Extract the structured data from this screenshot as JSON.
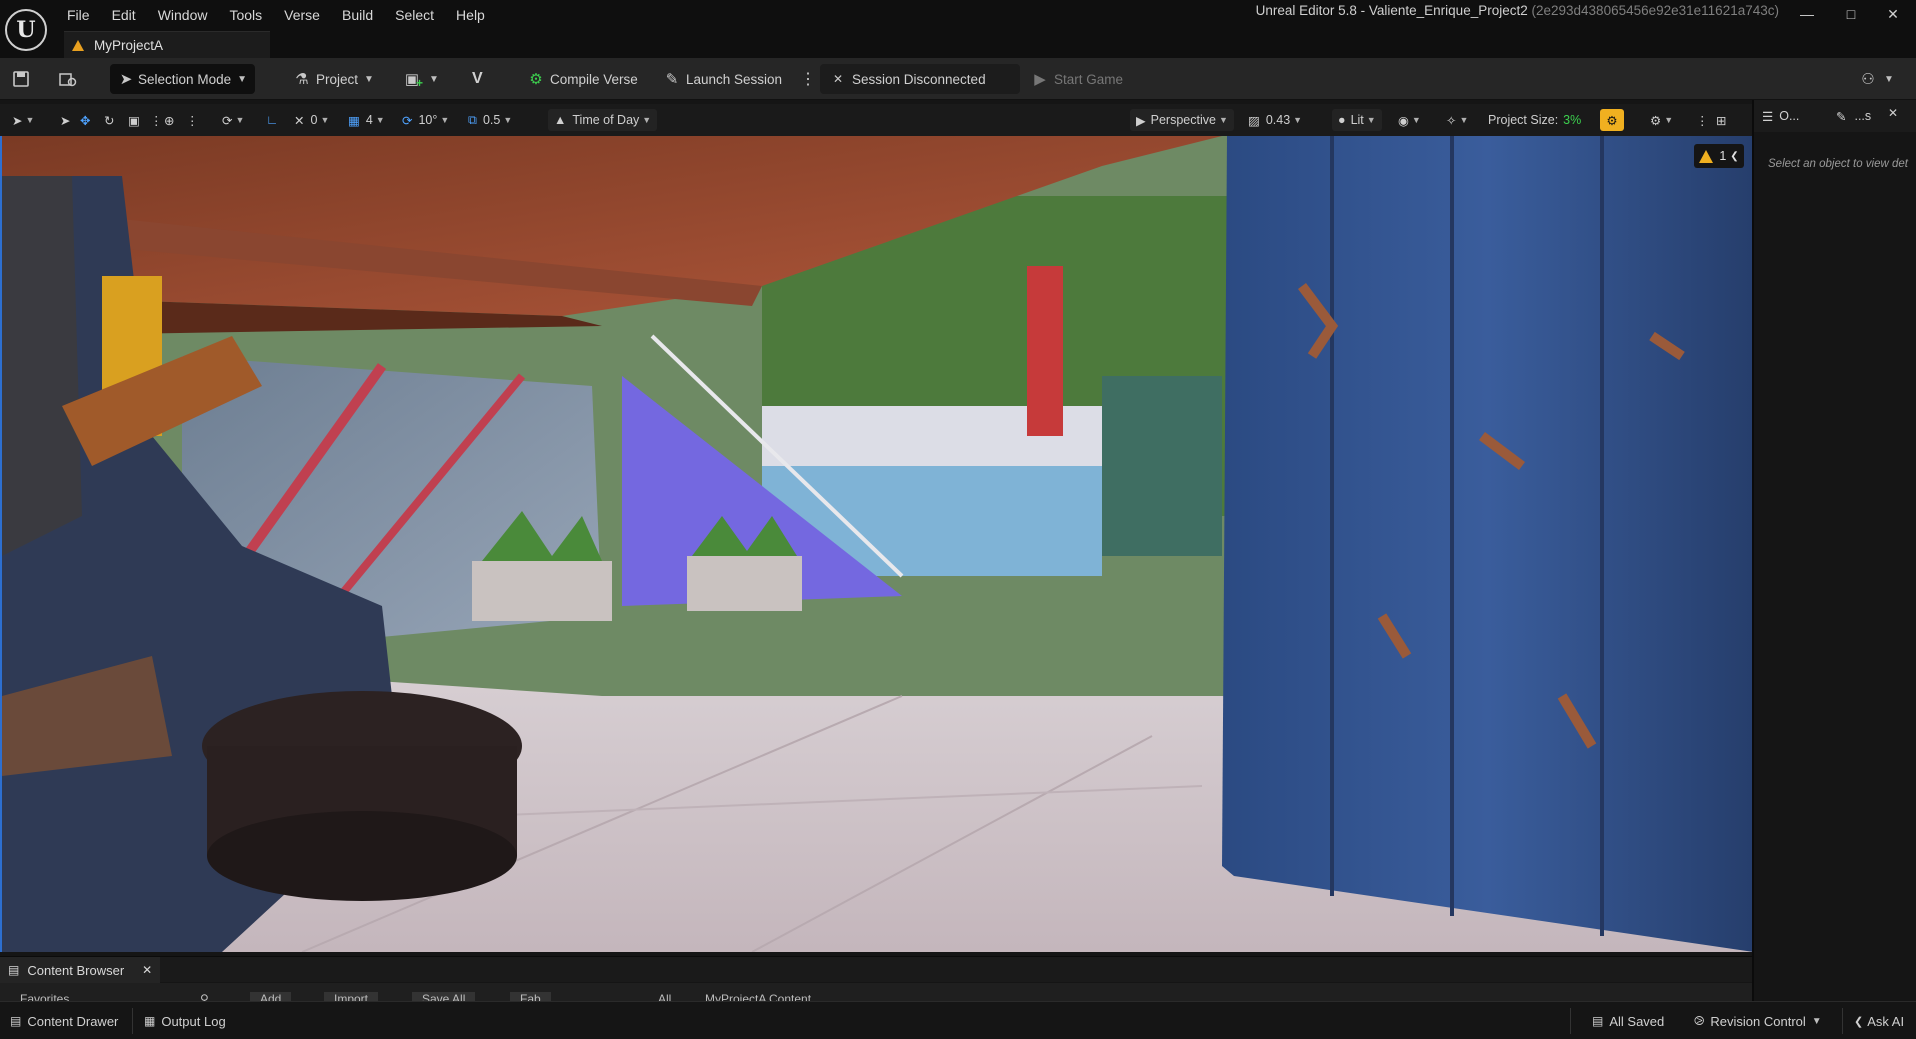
{
  "app": {
    "window_title": "Unreal Editor 5.8 - Valiente_Enrique_Project2",
    "window_hash": "(2e293d438065456e92e31e11621a743c)",
    "project_tab": "MyProjectA"
  },
  "menu": [
    "File",
    "Edit",
    "Window",
    "Tools",
    "Verse",
    "Build",
    "Select",
    "Help"
  ],
  "toolbar": {
    "selection_mode": "Selection Mode",
    "project": "Project",
    "compile_verse": "Compile Verse",
    "launch_session": "Launch Session",
    "session_status": "Session Disconnected",
    "start_game": "Start Game"
  },
  "viewport_toolbar": {
    "rotation_snap": "0",
    "grid_snap": "4",
    "angle_snap": "10°",
    "scale_snap": "0.5",
    "time_of_day": "Time of Day",
    "perspective": "Perspective",
    "camera_speed": "0.43",
    "view_mode": "Lit",
    "project_size_label": "Project Size:",
    "project_size_value": "3%"
  },
  "viewport": {
    "warning_count": "1"
  },
  "side_panel": {
    "outliner_tab": "O...",
    "details_tab": "...s",
    "hint": "Select an object to view det"
  },
  "content_browser": {
    "tab_label": "Content Browser",
    "ghost_favorites": "Favorites",
    "ghost_add": "Add",
    "ghost_import": "Import",
    "ghost_save_all": "Save All",
    "ghost_fab": "Fab",
    "ghost_path_all": "All",
    "ghost_path_content": "MyProjectA Content"
  },
  "statusbar": {
    "content_drawer": "Content Drawer",
    "output_log": "Output Log",
    "all_saved": "All Saved",
    "revision_control": "Revision Control",
    "ask_ai": "Ask AI"
  },
  "colors": {
    "accent_blue": "#4fa3ff",
    "project_size_green": "#3ccf4e",
    "warning_yellow": "#f0b020",
    "viewport_border": "#2d6fd0"
  }
}
